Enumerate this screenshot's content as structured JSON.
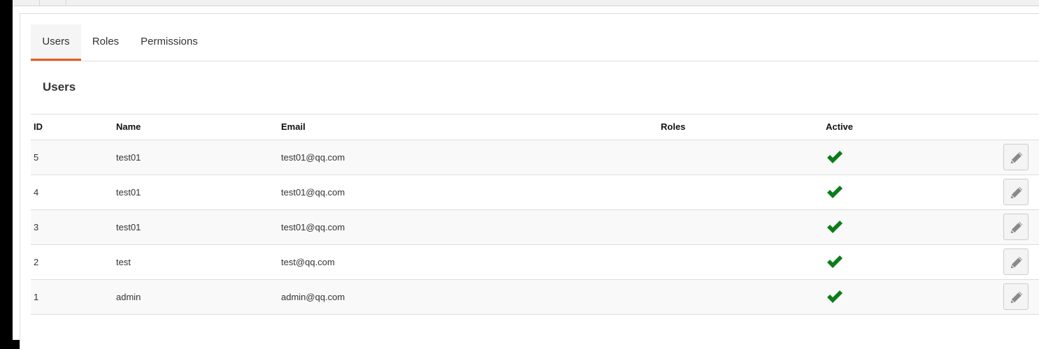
{
  "tabs": [
    {
      "label": "Users",
      "active": true
    },
    {
      "label": "Roles",
      "active": false
    },
    {
      "label": "Permissions",
      "active": false
    }
  ],
  "section": {
    "title": "Users"
  },
  "table": {
    "headers": {
      "id": "ID",
      "name": "Name",
      "email": "Email",
      "roles": "Roles",
      "active": "Active"
    },
    "rows": [
      {
        "id": "5",
        "name": "test01",
        "email": "test01@qq.com",
        "roles": "",
        "active": true
      },
      {
        "id": "4",
        "name": "test01",
        "email": "test01@qq.com",
        "roles": "",
        "active": true
      },
      {
        "id": "3",
        "name": "test01",
        "email": "test01@qq.com",
        "roles": "",
        "active": true
      },
      {
        "id": "2",
        "name": "test",
        "email": "test@qq.com",
        "roles": "",
        "active": true
      },
      {
        "id": "1",
        "name": "admin",
        "email": "admin@qq.com",
        "roles": "",
        "active": true
      }
    ]
  },
  "icons": {
    "active": "check-icon",
    "edit": "pencil-icon"
  },
  "colors": {
    "accent": "#e85d1e",
    "check": "#0a7d1a",
    "pencil": "#8a8a8a"
  }
}
